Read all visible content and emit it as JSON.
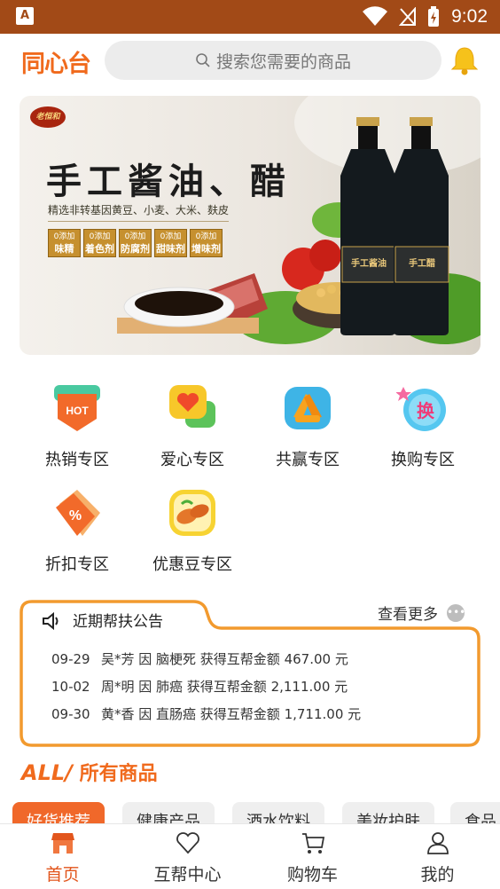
{
  "status_bar": {
    "time": "9:02",
    "app_badge": "A"
  },
  "header": {
    "logo": "同心台",
    "search_placeholder": "搜索您需要的商品"
  },
  "banner": {
    "brand": "老恒和",
    "title": "手工酱油、醋",
    "subtitle": "精选非转基因黄豆、小麦、大米、麸皮",
    "badges": [
      {
        "top": "0添加",
        "bottom": "味精"
      },
      {
        "top": "0添加",
        "bottom": "着色剂"
      },
      {
        "top": "0添加",
        "bottom": "防腐剂"
      },
      {
        "top": "0添加",
        "bottom": "甜味剂"
      },
      {
        "top": "0添加",
        "bottom": "增味剂"
      }
    ],
    "bottle_labels": [
      "手工酱油",
      "手工醋"
    ]
  },
  "categories": [
    {
      "label": "热销专区",
      "icon": "hot-tag-icon",
      "icon_text": "HOT"
    },
    {
      "label": "爱心专区",
      "icon": "heart-chat-icon"
    },
    {
      "label": "共赢专区",
      "icon": "handshake-icon"
    },
    {
      "label": "换购专区",
      "icon": "exchange-icon",
      "icon_text": "换"
    },
    {
      "label": "折扣专区",
      "icon": "discount-tag-icon",
      "icon_text": "%"
    },
    {
      "label": "优惠豆专区",
      "icon": "beans-icon"
    }
  ],
  "notice": {
    "title": "近期帮扶公告",
    "more": "查看更多",
    "rows": [
      {
        "date": "09-29",
        "text": "吴*芳 因 脑梗死 获得互帮金额 467.00 元"
      },
      {
        "date": "10-02",
        "text": "周*明 因 肺癌 获得互帮金额 2,111.00 元"
      },
      {
        "date": "09-30",
        "text": "黄*香 因 直肠癌 获得互帮金额 1,711.00 元"
      }
    ]
  },
  "all_goods": {
    "prefix": "ALL/",
    "label": "所有商品"
  },
  "tabs": [
    "好货推荐",
    "健康产品",
    "酒水饮料",
    "美妆护肤",
    "食品"
  ],
  "bottom_nav": [
    {
      "label": "首页",
      "icon": "home-shop-icon",
      "active": true
    },
    {
      "label": "互帮中心",
      "icon": "heart-icon",
      "active": false
    },
    {
      "label": "购物车",
      "icon": "cart-icon",
      "active": false
    },
    {
      "label": "我的",
      "icon": "user-icon",
      "active": false
    }
  ],
  "colors": {
    "accent": "#f06a1d",
    "status_bar": "#a24a17",
    "notice_border": "#f29a2e"
  }
}
